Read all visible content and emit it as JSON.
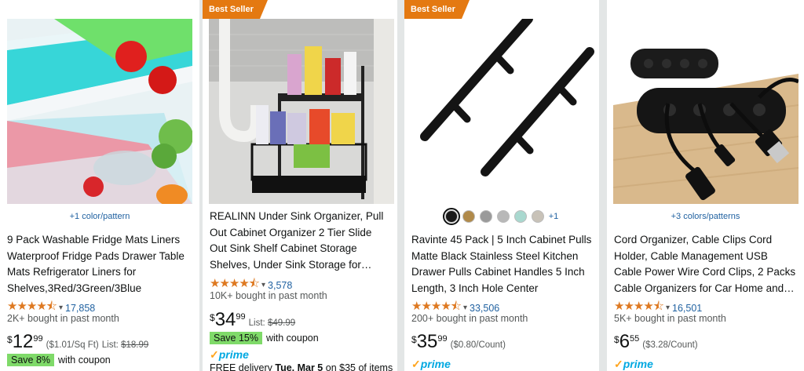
{
  "products": [
    {
      "variant_link": "+1 color/pattern",
      "title_lines": [
        "9 Pack Washable Fridge Mats Liners",
        "Waterproof Fridge Pads Drawer Table",
        "Mats Refrigerator Liners for",
        "Shelves,3Red/3Green/3Blue"
      ],
      "stars": "★★★★⯪",
      "rating_count": "17,858",
      "bought": "2K+ bought in past month",
      "price_symbol": "$",
      "price_whole": "12",
      "price_fraction": "99",
      "unit_price": "($1.01/Sq Ft)",
      "list_label": "List:",
      "list_price": "$18.99",
      "coupon_badge": "Save 8%",
      "coupon_text": "with coupon"
    },
    {
      "badge": "Best Seller",
      "title_lines": [
        "REALINN Under Sink Organizer, Pull",
        "Out Cabinet Organizer 2 Tier Slide",
        "Out Sink Shelf Cabinet Storage",
        "Shelves, Under Sink Storage for…"
      ],
      "stars": "★★★★⯪",
      "rating_count": "3,578",
      "bought": "10K+ bought in past month",
      "price_symbol": "$",
      "price_whole": "34",
      "price_fraction": "99",
      "list_label": "List:",
      "list_price": "$49.99",
      "coupon_badge": "Save 15%",
      "coupon_text": "with coupon",
      "prime": "prime",
      "delivery_prefix": "FREE delivery ",
      "delivery_date": "Tue, Mar 5",
      "delivery_suffix": " on $35 of items"
    },
    {
      "badge": "Best Seller",
      "swatch_colors": [
        "#1a1a1a",
        "#b08a4a",
        "#9a9a9a",
        "#b8b8b8",
        "#a9d8cf",
        "#c8c2b8"
      ],
      "swatch_more": "+1",
      "title_lines": [
        "Ravinte 45 Pack | 5 Inch Cabinet Pulls",
        "Matte Black Stainless Steel Kitchen",
        "Drawer Pulls Cabinet Handles 5 Inch",
        "Length, 3 Inch Hole Center"
      ],
      "stars": "★★★★⯪",
      "rating_count": "33,506",
      "bought": "200+ bought in past month",
      "price_symbol": "$",
      "price_whole": "35",
      "price_fraction": "99",
      "unit_price": "($0.80/Count)",
      "prime": "prime"
    },
    {
      "variant_link": "+3 colors/patterns",
      "title_lines": [
        "Cord Organizer, Cable Clips Cord",
        "Holder, Cable Management USB",
        "Cable Power Wire Cord Clips, 2 Packs",
        "Cable Organizers for Car Home and…"
      ],
      "stars": "★★★★⯪",
      "rating_count": "16,501",
      "bought": "5K+ bought in past month",
      "price_symbol": "$",
      "price_whole": "6",
      "price_fraction": "55",
      "unit_price": "($3.28/Count)",
      "prime": "prime"
    }
  ],
  "colors": {
    "link": "#2162a1",
    "star": "#de7921",
    "badge": "#e47911",
    "coupon": "#7fda69",
    "prime": "#00a8e1"
  }
}
